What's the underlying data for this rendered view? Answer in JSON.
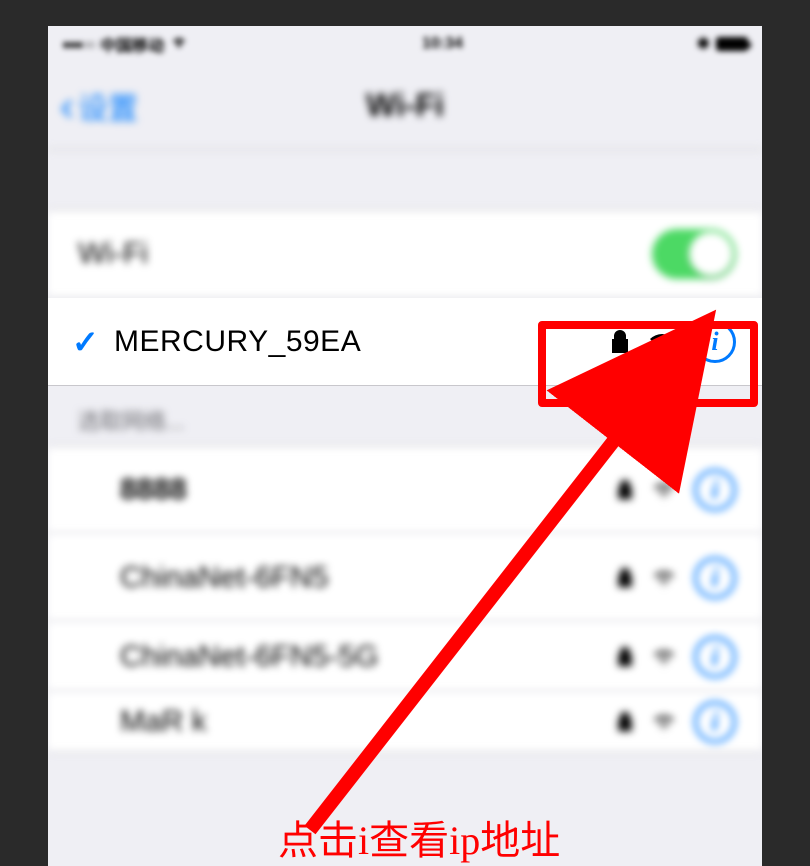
{
  "statusBar": {
    "carrier": "中国移动",
    "time": "10:34"
  },
  "nav": {
    "back": "设置",
    "title": "Wi-Fi"
  },
  "wifiToggle": {
    "label": "Wi-Fi"
  },
  "connected": {
    "name": "MERCURY_59EA"
  },
  "sectionHeader": "选取网络...",
  "networks": [
    {
      "name": "8888"
    },
    {
      "name": "ChinaNet-6FN5"
    },
    {
      "name": "ChinaNet-6FN5-5G"
    },
    {
      "name": "MaR k"
    }
  ],
  "annotation": "点击i查看ip地址",
  "infoGlyph": "i"
}
